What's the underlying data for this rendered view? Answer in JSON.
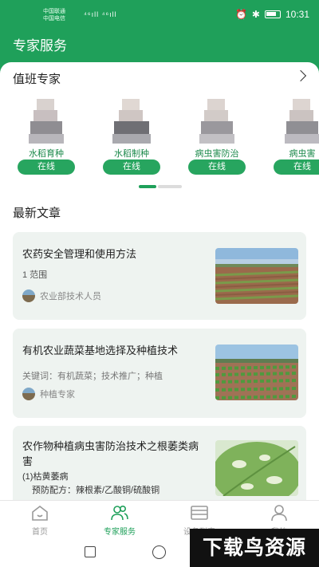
{
  "status_bar": {
    "carrier1": "中国联通",
    "carrier2": "中国电信",
    "signal": "⁴⁶ıll ⁴⁶ıll",
    "time": "10:31",
    "icons": [
      "alarm-icon",
      "bluetooth-icon",
      "battery-icon"
    ]
  },
  "header": {
    "title": "专家服务"
  },
  "duty_experts": {
    "title": "值班专家",
    "items": [
      {
        "name": "水稻育种",
        "status": "在线"
      },
      {
        "name": "水稻制种",
        "status": "在线"
      },
      {
        "name": "病虫害防治",
        "status": "在线"
      },
      {
        "name": "病虫害",
        "status": "在线"
      }
    ]
  },
  "latest_articles": {
    "title": "最新文章",
    "items": [
      {
        "title": "农药安全管理和使用方法",
        "meta": "1 范围",
        "author": "农业部技术人员"
      },
      {
        "title": "有机农业蔬菜基地选择及种植技术",
        "meta": "关键词：有机蔬菜；技术推广；种植",
        "author": "种植专家"
      },
      {
        "title": "农作物种植病虫害防治技术之根萎类病害",
        "meta": "(1)枯黄萎病",
        "meta2": "预防配方：辣根素/乙酸铜/硫酸铜"
      }
    ]
  },
  "tabbar": {
    "tabs": [
      {
        "label": "首页",
        "icon": "home-icon"
      },
      {
        "label": "专家服务",
        "icon": "experts-icon"
      },
      {
        "label": "设备列表",
        "icon": "device-list-icon"
      },
      {
        "label": "我的",
        "icon": "user-icon"
      }
    ],
    "active_index": 1
  },
  "watermark": "下载鸟资源",
  "colors": {
    "brand_green": "#1fa05a",
    "card_bg": "#eef3f0"
  }
}
